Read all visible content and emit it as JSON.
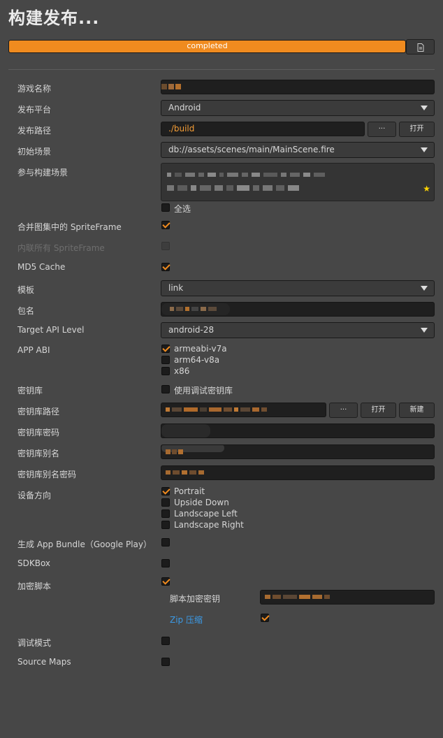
{
  "window": {
    "title": "构建发布..."
  },
  "progress": {
    "status": "completed",
    "percent": 100
  },
  "icons": {
    "log": "document-icon",
    "caret": "chevron-down-icon",
    "star": "star-icon",
    "check": "check-icon"
  },
  "colors": {
    "accent": "#f08b1f",
    "link": "#3b9ae6",
    "star": "#ffd400"
  },
  "buttons": {
    "browse": "···",
    "open": "打开",
    "new": "新建"
  },
  "fields": {
    "game_name": {
      "label": "游戏名称"
    },
    "platform": {
      "label": "发布平台",
      "value": "Android"
    },
    "build_path": {
      "label": "发布路径",
      "value": "./build"
    },
    "start_scene": {
      "label": "初始场景",
      "value": "db://assets/scenes/main/MainScene.fire"
    },
    "build_scenes": {
      "label": "参与构建场景",
      "select_all": "全选"
    },
    "merge_spriteframe": {
      "label": "合并图集中的 SpriteFrame",
      "checked": true
    },
    "inline_spriteframe": {
      "label": "内联所有 SpriteFrame",
      "checked": false,
      "disabled": true
    },
    "md5_cache": {
      "label": "MD5 Cache",
      "checked": true
    },
    "template": {
      "label": "模板",
      "value": "link"
    },
    "package_name": {
      "label": "包名"
    },
    "target_api": {
      "label": "Target API Level",
      "value": "android-28"
    },
    "app_abi": {
      "label": "APP ABI",
      "options": [
        {
          "name": "armeabi-v7a",
          "checked": true
        },
        {
          "name": "arm64-v8a",
          "checked": false
        },
        {
          "name": "x86",
          "checked": false
        }
      ]
    },
    "keystore": {
      "label": "密钥库",
      "option": "使用调试密钥库",
      "checked": false
    },
    "keystore_path": {
      "label": "密钥库路径"
    },
    "keystore_password": {
      "label": "密钥库密码"
    },
    "keystore_alias": {
      "label": "密钥库别名"
    },
    "keystore_alias_password": {
      "label": "密钥库别名密码"
    },
    "orientation": {
      "label": "设备方向",
      "options": [
        {
          "name": "Portrait",
          "checked": true
        },
        {
          "name": "Upside Down",
          "checked": false
        },
        {
          "name": "Landscape Left",
          "checked": false
        },
        {
          "name": "Landscape Right",
          "checked": false
        }
      ]
    },
    "app_bundle": {
      "label": "生成 App Bundle（Google Play）",
      "checked": false
    },
    "sdkbox": {
      "label": "SDKBox",
      "checked": false
    },
    "encrypt_js": {
      "label": "加密脚本",
      "checked": true
    },
    "encrypt_key": {
      "label": "脚本加密密钥"
    },
    "zip_compress": {
      "label": "Zip 压缩",
      "checked": true
    },
    "debug_mode": {
      "label": "调试模式",
      "checked": false
    },
    "source_maps": {
      "label": "Source Maps",
      "checked": false
    }
  }
}
